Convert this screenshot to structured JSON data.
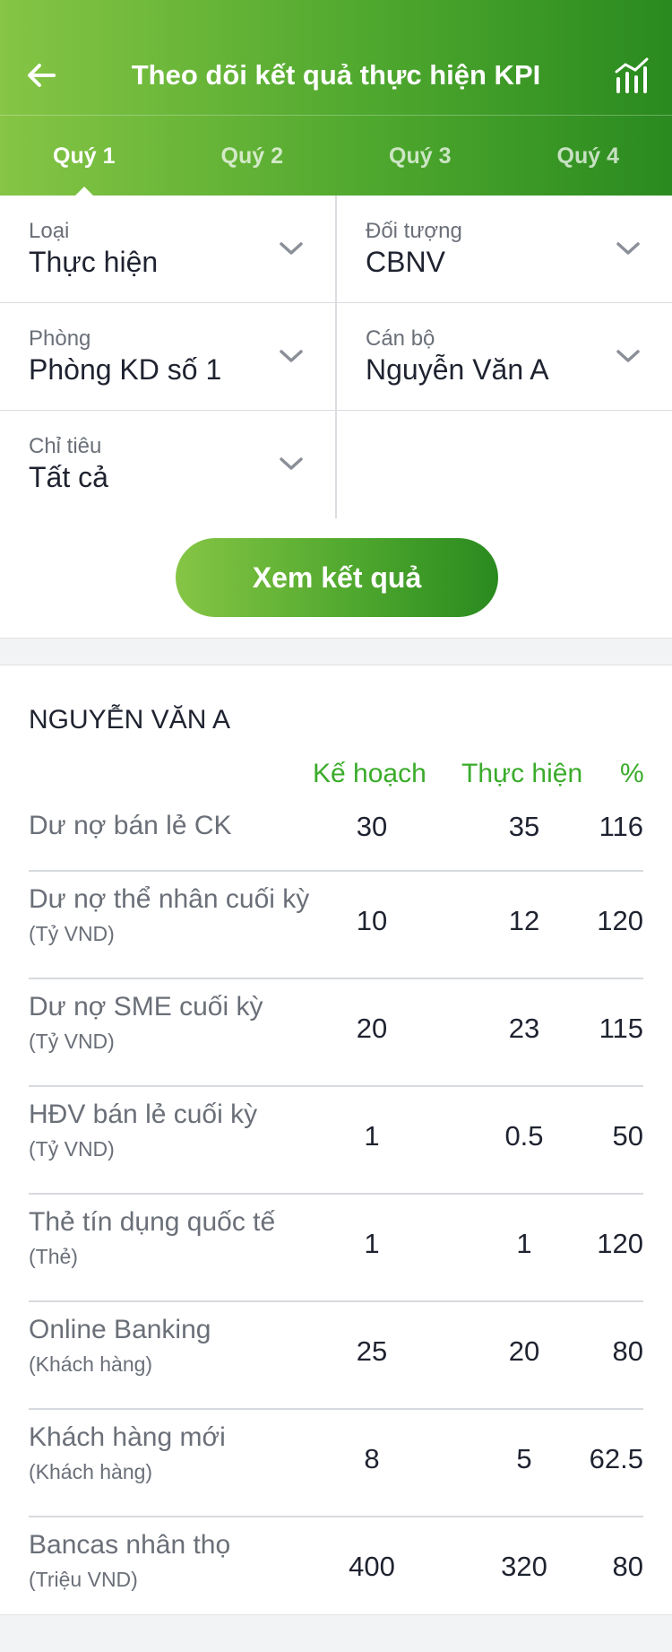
{
  "header": {
    "title": "Theo dõi kết quả thực hiện KPI",
    "back_icon": "arrow-left-icon",
    "chart_icon": "bar-chart-icon"
  },
  "tabs": [
    {
      "label": "Quý 1",
      "active": true
    },
    {
      "label": "Quý 2",
      "active": false
    },
    {
      "label": "Quý 3",
      "active": false
    },
    {
      "label": "Quý 4",
      "active": false
    }
  ],
  "filters": {
    "loai": {
      "label": "Loại",
      "value": "Thực hiện"
    },
    "doi_tuong": {
      "label": "Đối tượng",
      "value": "CBNV"
    },
    "phong": {
      "label": "Phòng",
      "value": "Phòng KD số 1"
    },
    "can_bo": {
      "label": "Cán bộ",
      "value": "Nguyễn Văn A"
    },
    "chi_tieu": {
      "label": "Chỉ tiêu",
      "value": "Tất cả"
    }
  },
  "submit_label": "Xem kết quả",
  "result": {
    "name": "NGUYỄN VĂN A",
    "columns": {
      "plan": "Kế hoạch",
      "actual": "Thực hiện",
      "percent": "%"
    },
    "rows": [
      {
        "label": "Dư nợ bán lẻ CK",
        "unit": "",
        "plan": "30",
        "actual": "35",
        "percent": "116"
      },
      {
        "label": "Dư nợ thể nhân cuối kỳ",
        "unit": "(Tỷ VND)",
        "plan": "10",
        "actual": "12",
        "percent": "120"
      },
      {
        "label": "Dư nợ SME cuối kỳ",
        "unit": "(Tỷ VND)",
        "plan": "20",
        "actual": "23",
        "percent": "115"
      },
      {
        "label": "HĐV bán lẻ cuối kỳ",
        "unit": "(Tỷ VND)",
        "plan": "1",
        "actual": "0.5",
        "percent": "50"
      },
      {
        "label": "Thẻ tín dụng quốc tế",
        "unit": "(Thẻ)",
        "plan": "1",
        "actual": "1",
        "percent": "120"
      },
      {
        "label": "Online Banking",
        "unit": "(Khách hàng)",
        "plan": "25",
        "actual": "20",
        "percent": "80"
      },
      {
        "label": "Khách hàng mới",
        "unit": "(Khách hàng)",
        "plan": "8",
        "actual": "5",
        "percent": "62.5"
      },
      {
        "label": "Bancas nhân thọ",
        "unit": "(Triệu VND)",
        "plan": "400",
        "actual": "320",
        "percent": "80"
      }
    ]
  },
  "colors": {
    "brand_light": "#86c545",
    "brand_dark": "#2a8a1f",
    "accent_text": "#3aab2a"
  }
}
